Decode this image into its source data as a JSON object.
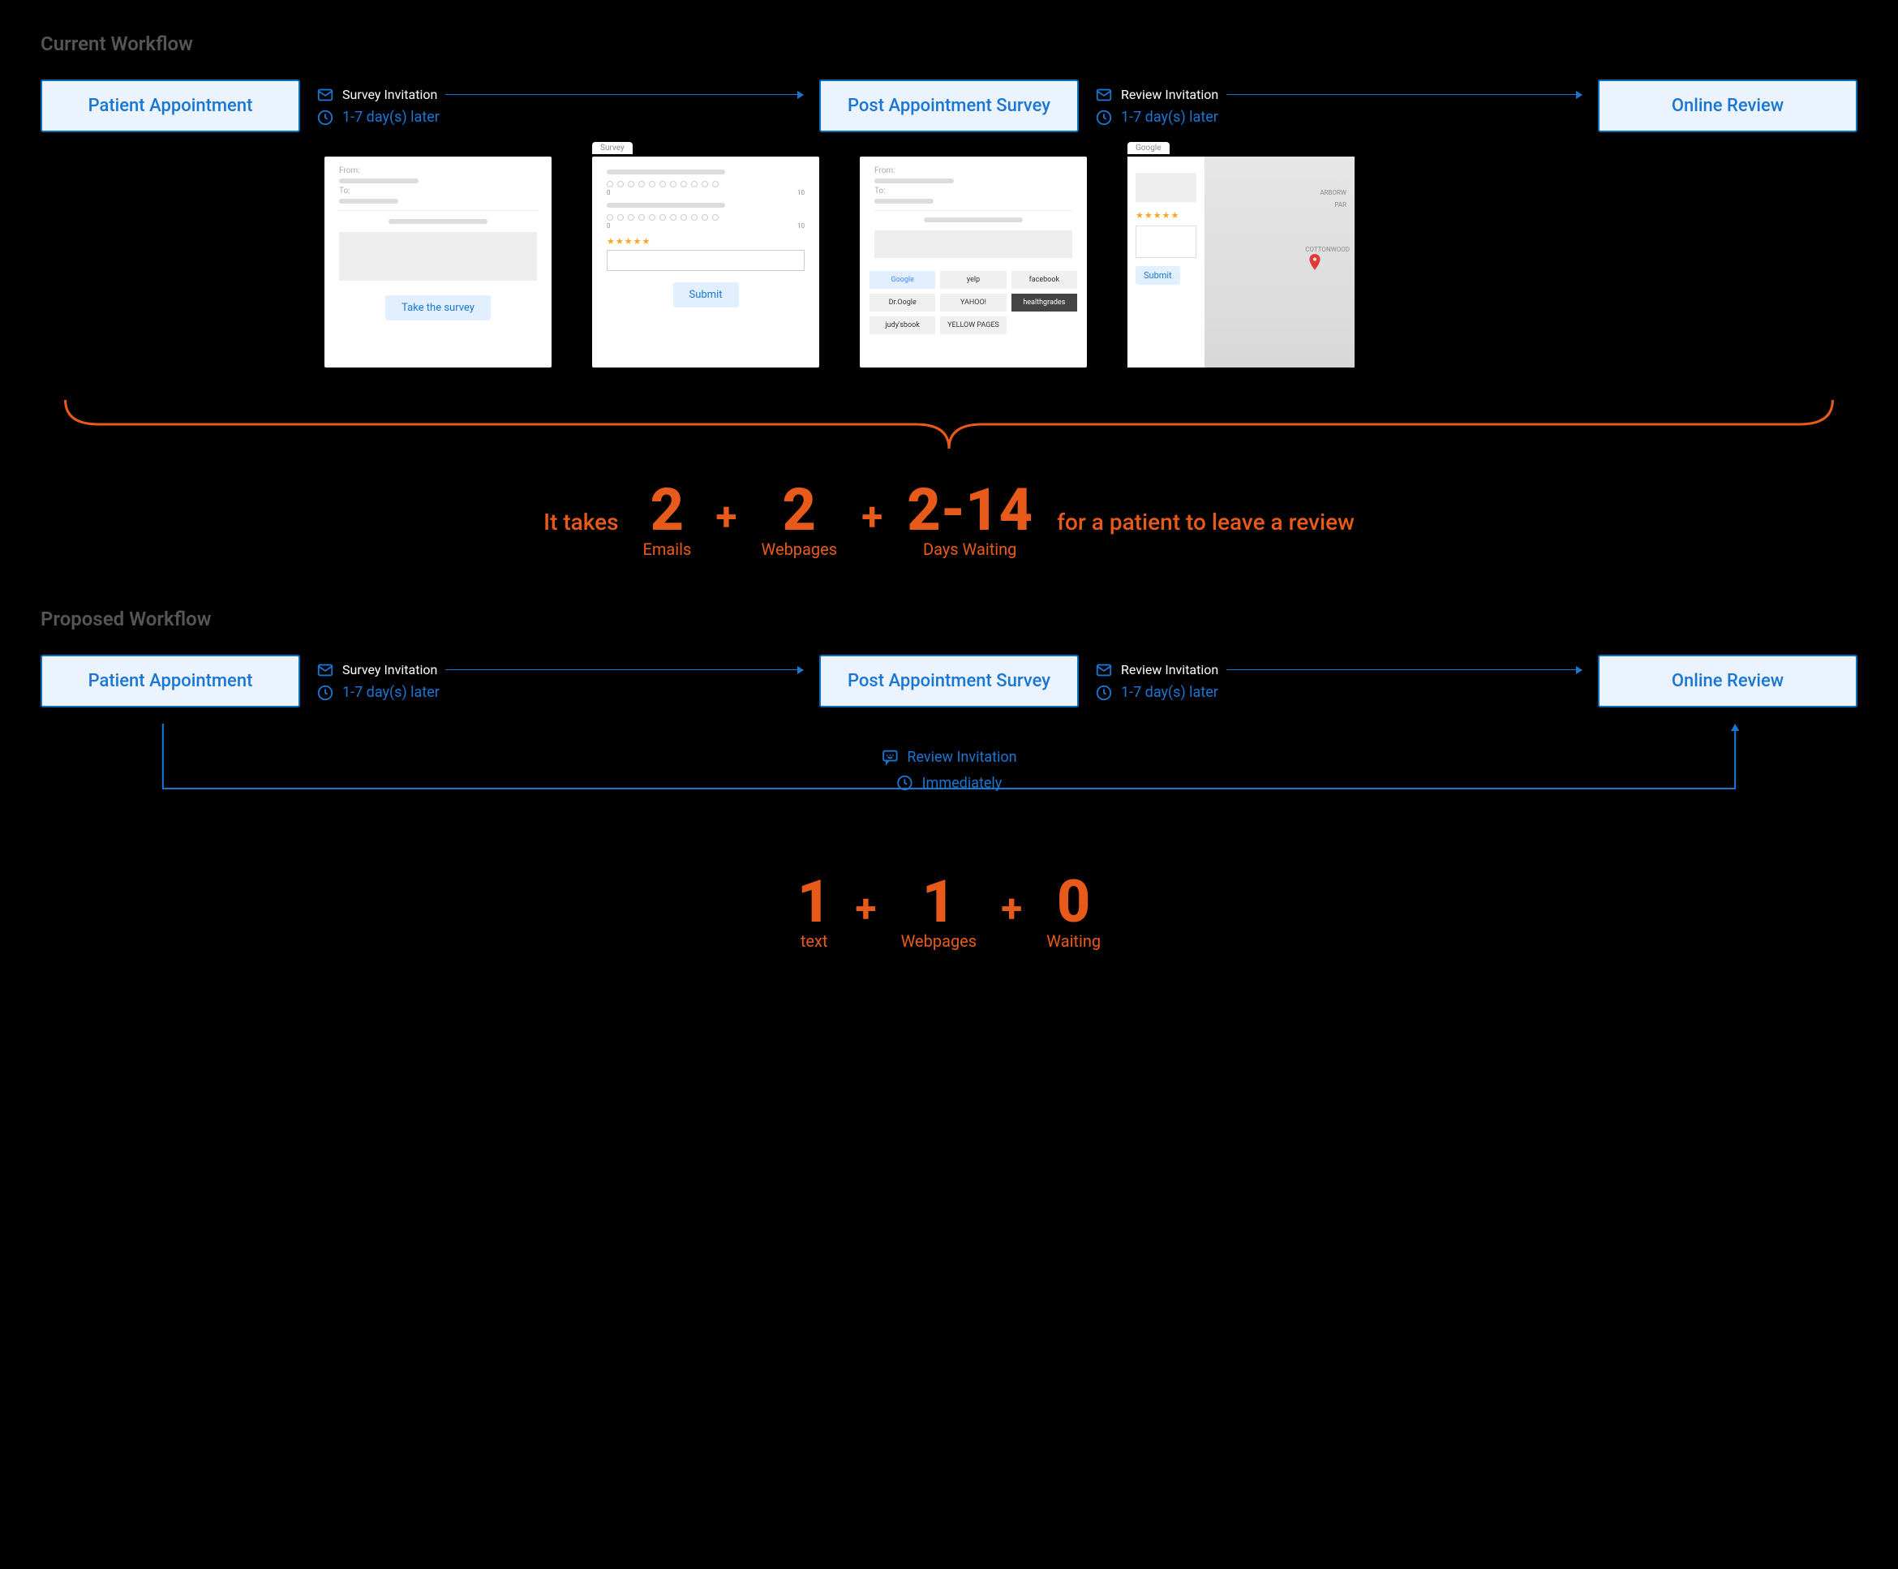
{
  "sections": {
    "current": {
      "title": "Current Workflow",
      "nodes": [
        "Patient Appointment",
        "Post Appointment Survey",
        "Online Review"
      ],
      "arrows": {
        "a1_top_label": "Survey Invitation",
        "a1_bottom_label": "1-7 day(s) later",
        "a2_top_label": "Review Invitation",
        "a2_bottom_label": "1-7 day(s) later"
      }
    },
    "proposed": {
      "title": "Proposed Workflow",
      "nodes": [
        "Patient Appointment",
        "Post Appointment Survey",
        "Online Review"
      ],
      "arrows": {
        "a1_top_label": "Survey Invitation",
        "a1_bottom_label": "1-7 day(s) later",
        "a2_top_label": "Review Invitation",
        "a2_bottom_label": "1-7 day(s) later"
      },
      "return_arrow": {
        "top_label": "Review Invitation",
        "bottom_label": "Immediately"
      }
    }
  },
  "mockups": {
    "email1": {
      "from_label": "From:",
      "to_label": "To:",
      "button": "Take the survey"
    },
    "survey": {
      "tab": "Survey",
      "scale_min": "0",
      "scale_max": "10",
      "button": "Submit"
    },
    "email2": {
      "from_label": "From:",
      "to_label": "To:",
      "sites": [
        "Google",
        "yelp",
        "facebook",
        "Dr.Oogle",
        "YAHOO!",
        "healthgrades",
        "judy'sbook",
        "YELLOW PAGES"
      ]
    },
    "google": {
      "tab": "Google",
      "button": "Submit",
      "map_labels": [
        "ARBORW",
        "COTTONWOOD",
        "PAR"
      ]
    }
  },
  "summary_current": {
    "lead": "It takes",
    "stats": [
      {
        "value": "2",
        "label": "Emails"
      },
      {
        "value": "2",
        "label": "Webpages"
      },
      {
        "value": "2-14",
        "label": "Days Waiting"
      }
    ],
    "trail": "for a patient to leave a review"
  },
  "summary_proposed": {
    "stats": [
      {
        "value": "1",
        "label": "text"
      },
      {
        "value": "1",
        "label": "Webpages"
      },
      {
        "value": "0",
        "label": "Waiting"
      }
    ]
  },
  "colors": {
    "accent_blue": "#1976d2",
    "accent_orange": "#e85a1a"
  }
}
